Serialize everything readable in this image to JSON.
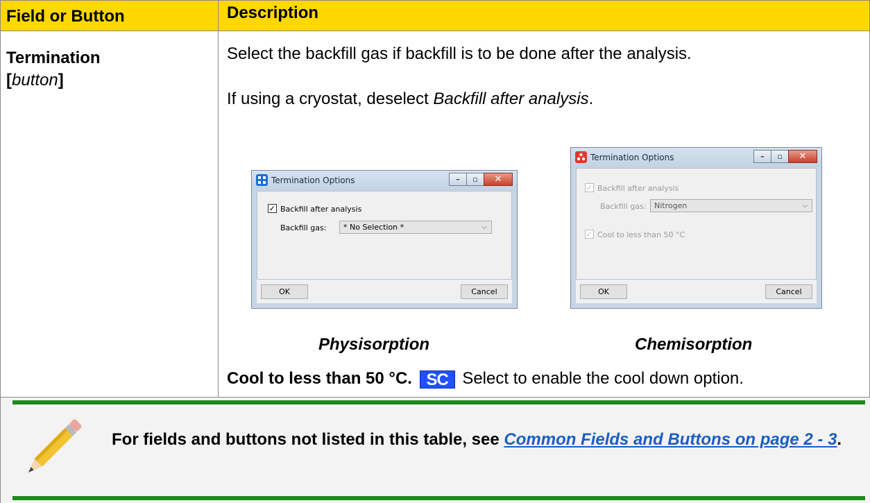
{
  "table": {
    "header_field": "Field or Button",
    "header_description": "Description",
    "field_name": "Termination",
    "field_type_open": "[",
    "field_type": "button",
    "field_type_close": "]",
    "desc_line1": "Select the backfill gas if backfill is to be done after the analysis.",
    "desc_line2_prefix": "If using a cryostat, deselect ",
    "desc_line2_italic": "Backfill after analysis",
    "desc_line2_suffix": "."
  },
  "physisorption_dialog": {
    "title": "Termination Options",
    "backfill_checkbox_label": "Backfill after analysis",
    "backfill_checked": true,
    "backfill_gas_label": "Backfill gas:",
    "backfill_gas_value": "* No Selection *",
    "ok_label": "OK",
    "cancel_label": "Cancel",
    "icon_color": "#1e6fd6"
  },
  "chemisorption_dialog": {
    "title": "Termination Options",
    "backfill_checkbox_label": "Backfill after analysis",
    "backfill_checked": true,
    "backfill_gas_label": "Backfill gas:",
    "backfill_gas_value": "Nitrogen",
    "cool_checkbox_label": "Cool to less than 50 °C",
    "cool_checked": true,
    "ok_label": "OK",
    "cancel_label": "Cancel",
    "icon_color": "#e0382a"
  },
  "captions": {
    "physisorption": "Physisorption",
    "chemisorption": "Chemisorption"
  },
  "cool_option": {
    "label": "Cool to less than 50 °C.",
    "badge": "SC",
    "badge_color": "#2050ff",
    "description": "Select to enable the cool down option."
  },
  "note": {
    "text_prefix": "For fields and buttons not listed in this table, see ",
    "link_text": "Common Fields and Buttons on page 2 - 3",
    "text_suffix": ".",
    "accent_color": "#1c8a1c"
  }
}
